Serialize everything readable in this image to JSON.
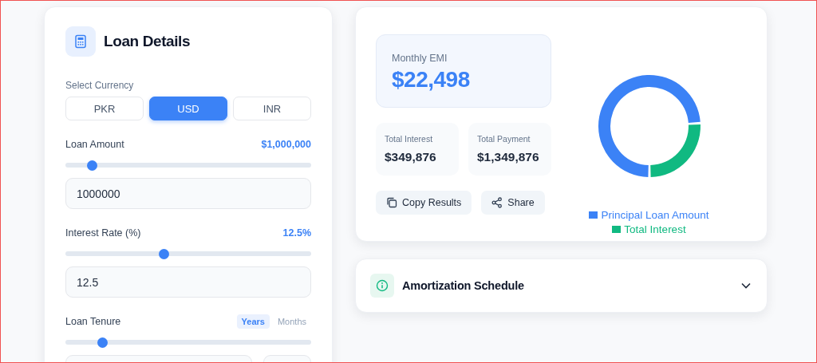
{
  "loan_details": {
    "title": "Loan Details",
    "currency_label": "Select Currency",
    "currencies": [
      {
        "label": "PKR",
        "selected": false
      },
      {
        "label": "USD",
        "selected": true
      },
      {
        "label": "INR",
        "selected": false
      }
    ],
    "amount": {
      "label": "Loan Amount",
      "reading": "$1,000,000",
      "level": 0.11,
      "value": "1000000"
    },
    "rate": {
      "label": "Interest Rate (%)",
      "reading": "12.5%",
      "level": 0.4,
      "value": "12.5"
    },
    "tenure": {
      "label": "Loan Tenure",
      "units": [
        {
          "label": "Years",
          "selected": true
        },
        {
          "label": "Months",
          "selected": false
        }
      ],
      "level": 0.15
    }
  },
  "results": {
    "emi_label": "Monthly EMI",
    "emi": "$22,498",
    "stats": [
      {
        "label": "Total Interest",
        "value": "$349,876"
      },
      {
        "label": "Total Payment",
        "value": "$1,349,876"
      }
    ],
    "buttons": [
      {
        "kind": "copy",
        "label": "Copy Results"
      },
      {
        "kind": "share",
        "label": "Share"
      }
    ],
    "chart_data": {
      "type": "donut",
      "categories": [
        "Principal Loan Amount",
        "Total Interest"
      ],
      "values": [
        74.1,
        25.9
      ],
      "legend": "bottom",
      "colors": [
        "#3b82f6",
        "#10b981"
      ]
    }
  },
  "amortization": {
    "title": "Amortization Schedule",
    "expanded": false
  }
}
